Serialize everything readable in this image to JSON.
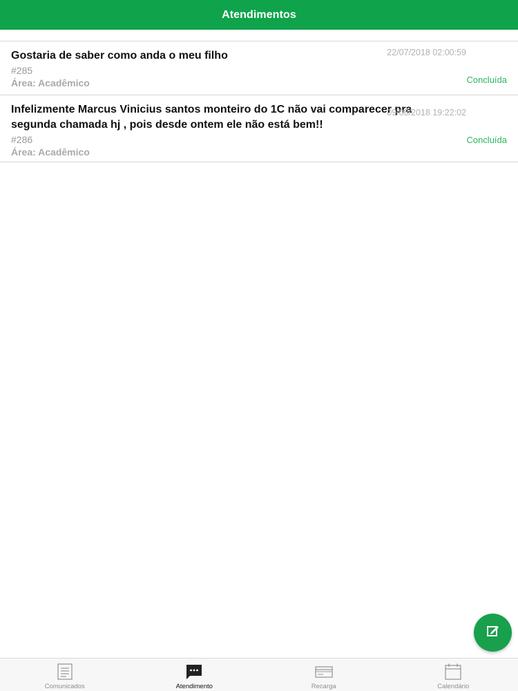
{
  "header": {
    "title": "Atendimentos"
  },
  "items": [
    {
      "title": "Gostaria de saber como anda o meu filho",
      "number": "#285",
      "area": "Área: Acadêmico",
      "date": "22/07/2018 02:00:59",
      "status": "Concluída"
    },
    {
      "title": "Infelizmente Marcus Vinicius santos monteiro do 1C não vai comparecer pra segunda chamada hj , pois desde ontem ele não está bem!!",
      "number": "#286",
      "area": "Área: Acadêmico",
      "date": "09/08/2018 19:22:02",
      "status": "Concluída"
    }
  ],
  "fab": {
    "icon": "compose-icon"
  },
  "tabs": [
    {
      "label": "Comunicados",
      "icon": "document-icon",
      "active": false
    },
    {
      "label": "Atendimento",
      "icon": "chat-bubble-icon",
      "active": true
    },
    {
      "label": "Recarga",
      "icon": "card-icon",
      "active": false
    },
    {
      "label": "Calendário",
      "icon": "calendar-icon",
      "active": false
    }
  ],
  "colors": {
    "primary": "#0fa34b",
    "status": "#2cb55e",
    "fab": "#18a04d"
  }
}
